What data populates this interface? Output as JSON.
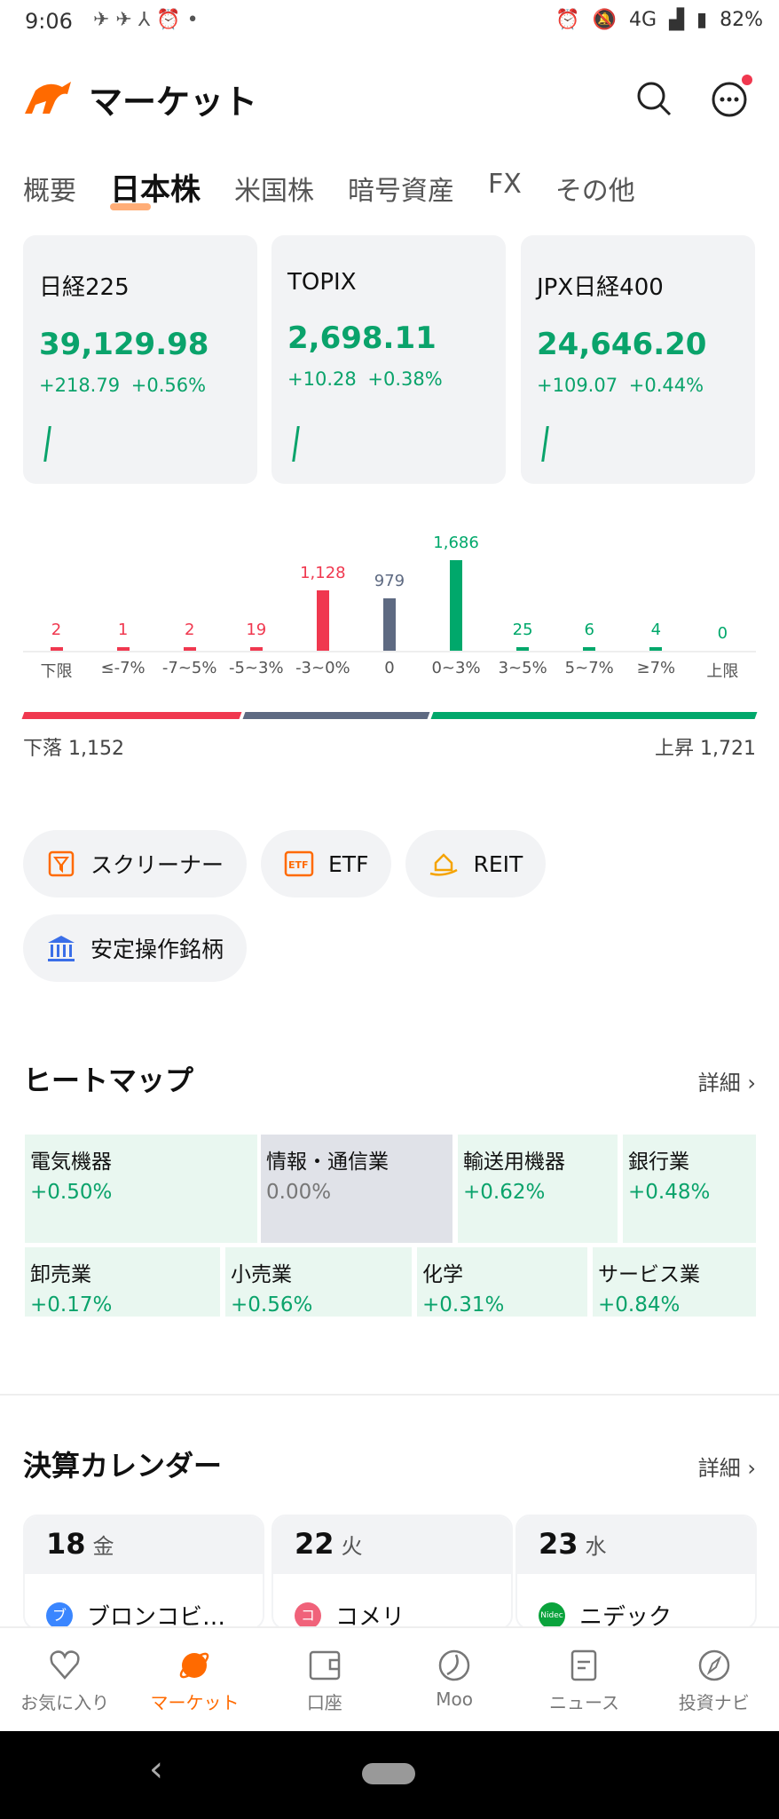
{
  "status_bar": {
    "time": "9:06",
    "network": "4G",
    "battery": "82%"
  },
  "header": {
    "title": "マーケット",
    "has_notification": true
  },
  "tabs": [
    {
      "label": "概要"
    },
    {
      "label": "日本株",
      "active": true
    },
    {
      "label": "米国株"
    },
    {
      "label": "暗号資産"
    },
    {
      "label": "FX"
    },
    {
      "label": "その他"
    }
  ],
  "indices": [
    {
      "name": "日経225",
      "value": "39,129.98",
      "change": "+218.79",
      "pct": "+0.56%"
    },
    {
      "name": "TOPIX",
      "value": "2,698.11",
      "change": "+10.28",
      "pct": "+0.38%"
    },
    {
      "name": "JPX日経400",
      "value": "24,646.20",
      "change": "+109.07",
      "pct": "+0.44%"
    }
  ],
  "chart_data": {
    "type": "bar",
    "categories": [
      "下限",
      "≤-7%",
      "-7~5%",
      "-5~3%",
      "-3~0%",
      "0",
      "0~3%",
      "3~5%",
      "5~7%",
      "≥7%",
      "上限"
    ],
    "values": [
      2,
      1,
      2,
      19,
      1128,
      979,
      1686,
      25,
      6,
      4,
      0
    ],
    "value_labels": [
      "2",
      "1",
      "2",
      "19",
      "1,128",
      "979",
      "1,686",
      "25",
      "6",
      "4",
      "0"
    ],
    "colors": [
      "#f0384f",
      "#f0384f",
      "#f0384f",
      "#f0384f",
      "#f0384f",
      "#5e6a82",
      "#00a86b",
      "#00a86b",
      "#00a86b",
      "#00a86b",
      "#00a86b"
    ]
  },
  "breadth": {
    "fall_label": "下落",
    "fall": "1,152",
    "flat": 979,
    "rise_label": "上昇",
    "rise": "1,721",
    "fall_count": 1152,
    "rise_count": 1721
  },
  "shortcuts": [
    {
      "label": "スクリーナー",
      "icon": "filter-icon"
    },
    {
      "label": "ETF",
      "icon": "etf-icon"
    },
    {
      "label": "REIT",
      "icon": "building-hand-icon"
    },
    {
      "label": "安定操作銘柄",
      "icon": "bank-icon"
    }
  ],
  "heatmap": {
    "title": "ヒートマップ",
    "more": "詳細",
    "tiles": [
      {
        "name": "電気機器",
        "pct": "+0.50%"
      },
      {
        "name": "情報・通信業",
        "pct": "0.00%"
      },
      {
        "name": "輸送用機器",
        "pct": "+0.62%"
      },
      {
        "name": "銀行業",
        "pct": "+0.48%"
      },
      {
        "name": "卸売業",
        "pct": "+0.17%"
      },
      {
        "name": "小売業",
        "pct": "+0.56%"
      },
      {
        "name": "化学",
        "pct": "+0.31%"
      },
      {
        "name": "サービス業",
        "pct": "+0.84%"
      }
    ]
  },
  "calendar": {
    "title": "決算カレンダー",
    "more": "詳細",
    "days": [
      {
        "day": "18",
        "weekday": "金",
        "company": "ブロンコビ…",
        "logo": "ブ",
        "color": "#3a86ff"
      },
      {
        "day": "22",
        "weekday": "火",
        "company": "コメリ",
        "logo": "コ",
        "color": "#f0627a"
      },
      {
        "day": "23",
        "weekday": "水",
        "company": "ニデック",
        "logo": "Nidec",
        "color": "#0aa33c"
      }
    ]
  },
  "bottom_nav": [
    {
      "label": "お気に入り",
      "icon": "heart-icon"
    },
    {
      "label": "マーケット",
      "icon": "planet-icon",
      "active": true
    },
    {
      "label": "口座",
      "icon": "wallet-icon"
    },
    {
      "label": "Moo",
      "icon": "moo-icon"
    },
    {
      "label": "ニュース",
      "icon": "news-icon"
    },
    {
      "label": "投資ナビ",
      "icon": "compass-icon"
    }
  ],
  "colors": {
    "accent": "#ff6a00",
    "up": "#00a86b",
    "down": "#f0384f",
    "flat": "#5e6a82"
  }
}
